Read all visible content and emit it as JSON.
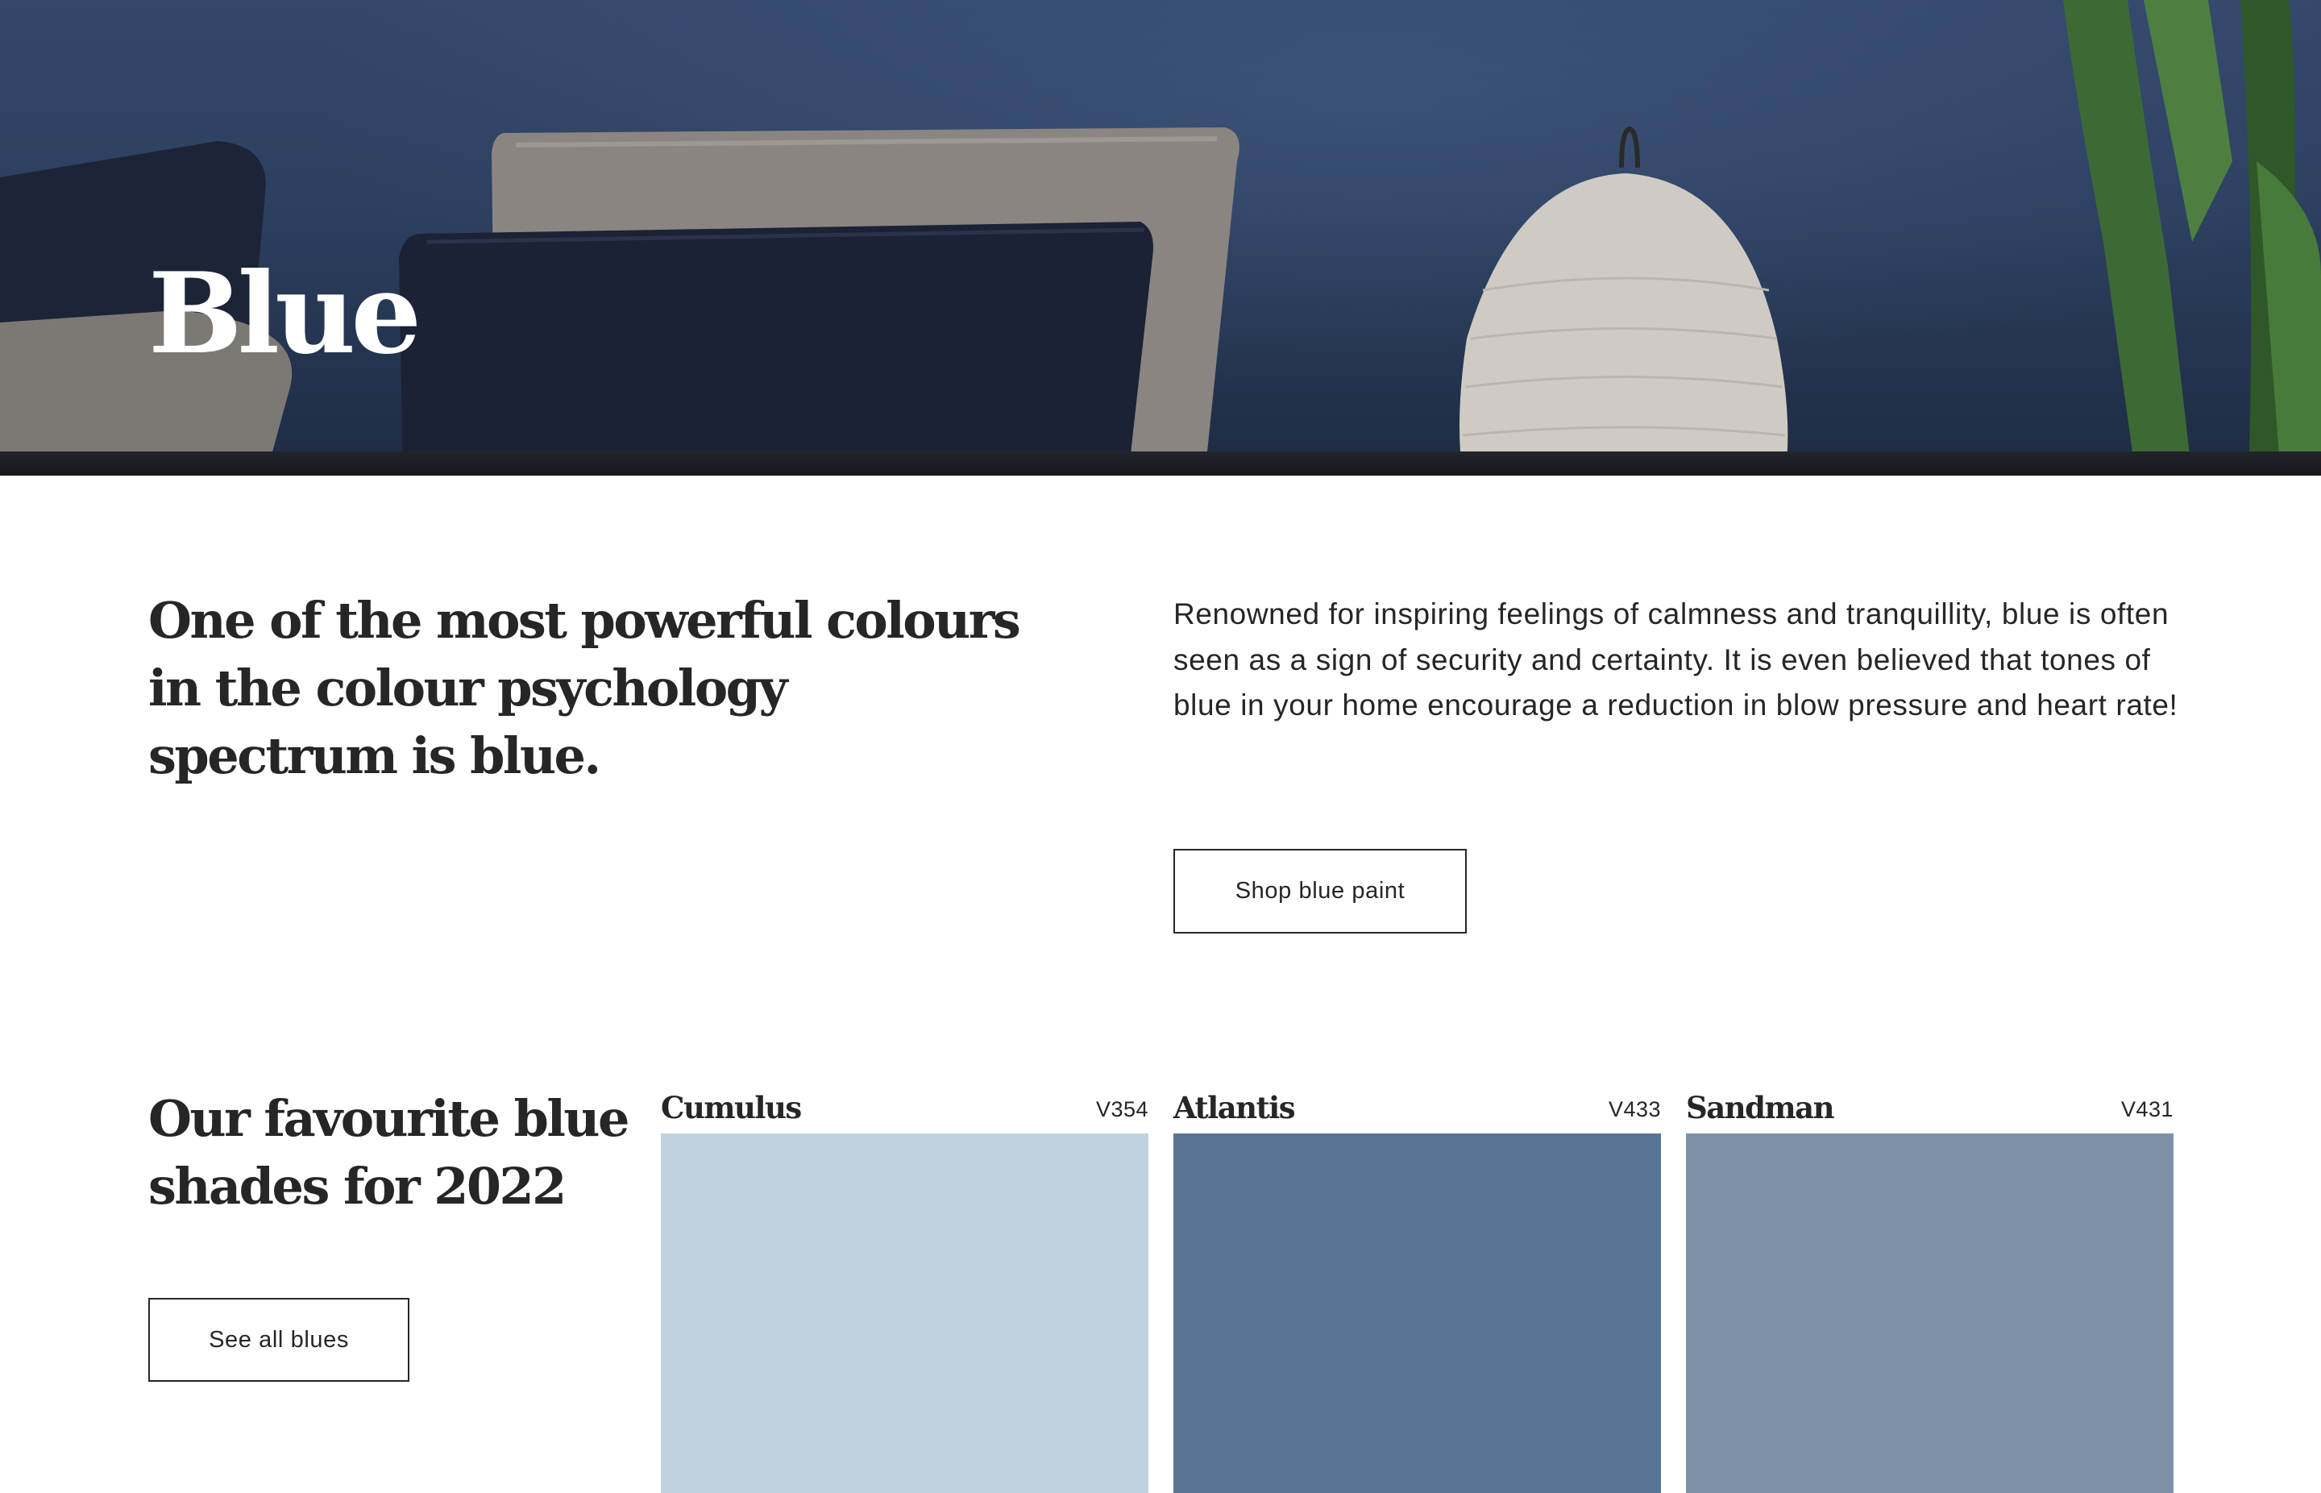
{
  "hero": {
    "title": "Blue"
  },
  "intro": {
    "heading": "One of the most powerful colours in the colour psychology spectrum is blue.",
    "body": "Renowned for inspiring feelings of calmness and tranquillity, blue is often seen as a sign of security and certainty. It is even believed that tones of blue in your home encourage a reduction in blow pressure and heart rate!",
    "shop_button": "Shop blue paint"
  },
  "shades": {
    "heading": "Our favourite blue shades for 2022",
    "see_all_button": "See all blues",
    "swatches": [
      {
        "name": "Cumulus",
        "code": "V354",
        "color": "#c0d2df"
      },
      {
        "name": "Atlantis",
        "code": "V433",
        "color": "#587595"
      },
      {
        "name": "Sandman",
        "code": "V431",
        "color": "#7d92a8"
      }
    ]
  }
}
